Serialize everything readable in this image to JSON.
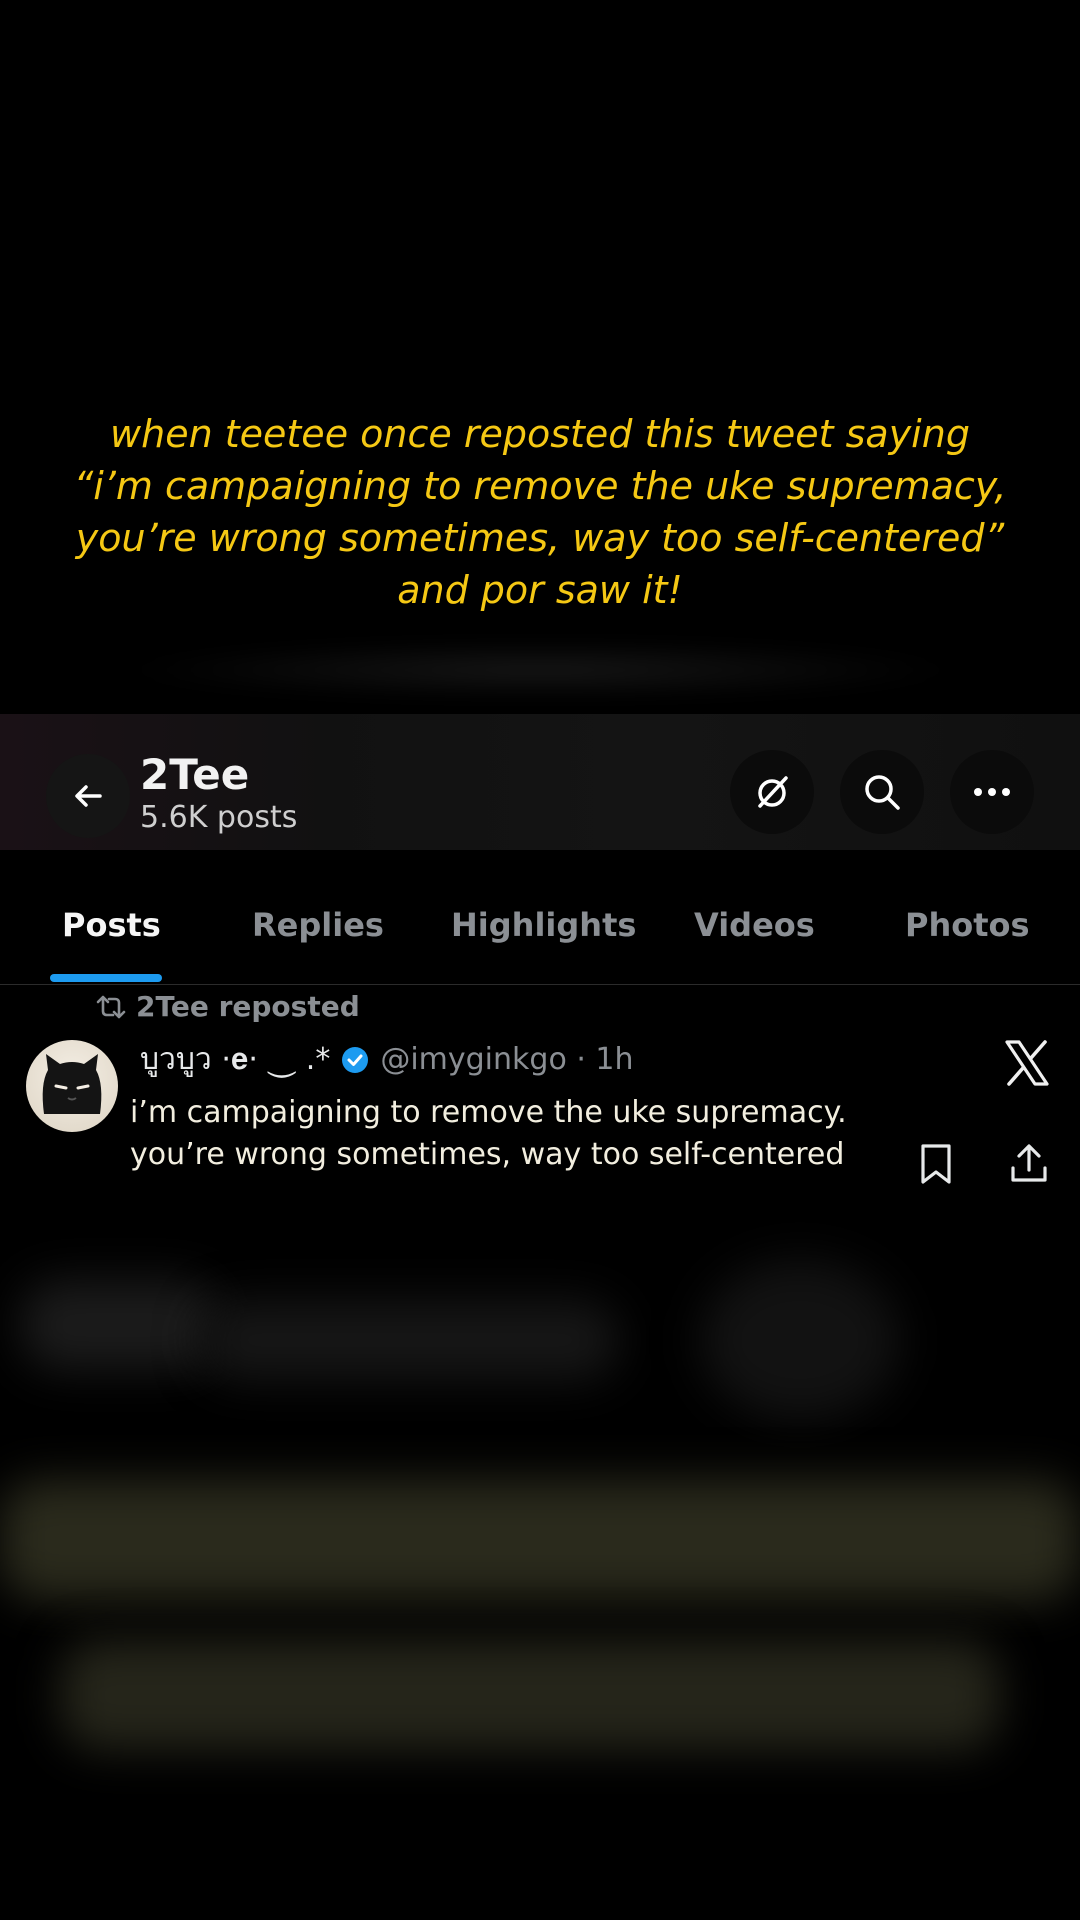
{
  "caption": {
    "line1": "when teetee once reposted this tweet saying",
    "line2": "“i’m campaigning to remove the uke supremacy,",
    "line3": "you’re wrong sometimes, way too self-centered”",
    "line4": "and por saw it!"
  },
  "header": {
    "title": "2Tee",
    "subtitle": "5.6K posts"
  },
  "tabs": [
    {
      "label": "Posts"
    },
    {
      "label": "Replies"
    },
    {
      "label": "Highlights"
    },
    {
      "label": "Videos"
    },
    {
      "label": "Photos"
    }
  ],
  "tweet": {
    "repost_label": "2Tee reposted",
    "author_name": "บูวบูว ·𝐞· ⏝ .*",
    "handle_time": "@imyginkgo · 1h",
    "line1": "i’m campaigning to remove the uke supremacy.",
    "line2": "you’re wrong sometimes, way too self-centered"
  },
  "colors": {
    "caption": "#f5c814",
    "accent": "#1d9bf0"
  }
}
